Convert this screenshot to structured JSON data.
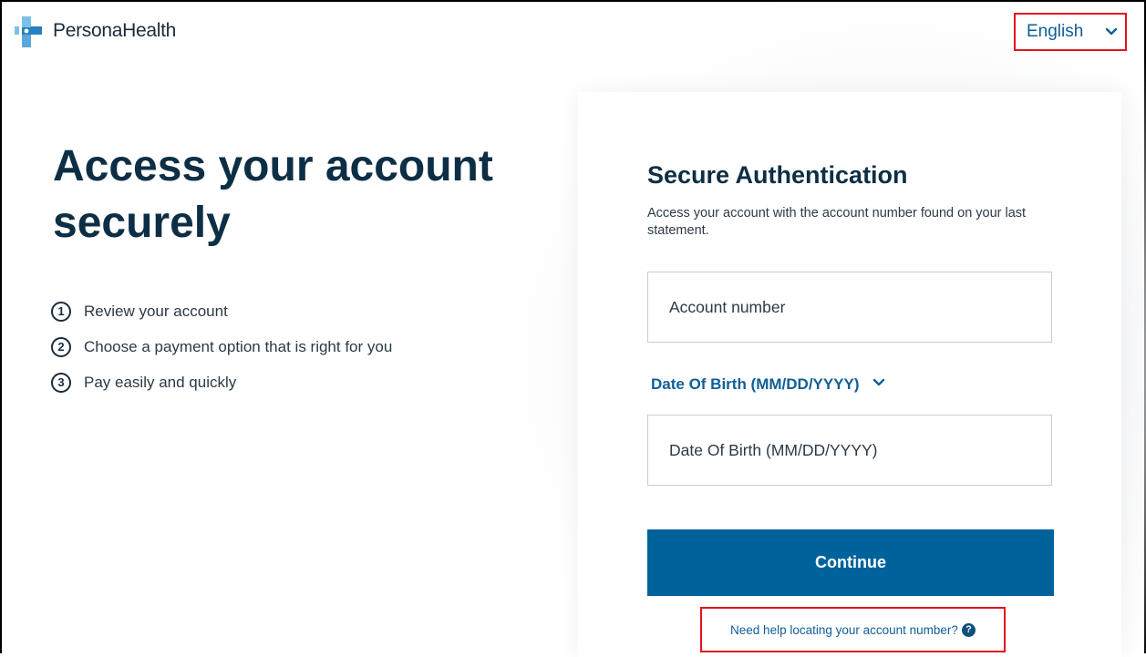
{
  "brand": {
    "name": "PersonaHealth",
    "colors": {
      "primary": "#00629b",
      "heading": "#0d2f45",
      "link": "#0f5f97",
      "logo_light": "#7cc0ea",
      "logo_dark": "#2a7fc0",
      "highlight": "#e0141e"
    }
  },
  "header": {
    "language": {
      "selected": "English",
      "icon": "chevron-down-icon"
    }
  },
  "hero": {
    "title": "Access your account securely",
    "steps": [
      {
        "num": "1",
        "text": "Review your account"
      },
      {
        "num": "2",
        "text": "Choose a payment option that is right for you"
      },
      {
        "num": "3",
        "text": "Pay easily and quickly"
      }
    ]
  },
  "auth_card": {
    "title": "Secure Authentication",
    "subtitle": "Access your account with the account number found on your last statement.",
    "account_field": {
      "placeholder": "Account number",
      "value": ""
    },
    "dob_toggle_label": "Date Of Birth (MM/DD/YYYY)",
    "dob_field": {
      "placeholder": "Date Of Birth (MM/DD/YYYY)",
      "value": ""
    },
    "continue_label": "Continue",
    "help_link": {
      "text": "Need help locating your account number?",
      "icon": "question-circle-icon",
      "icon_glyph": "?"
    }
  }
}
